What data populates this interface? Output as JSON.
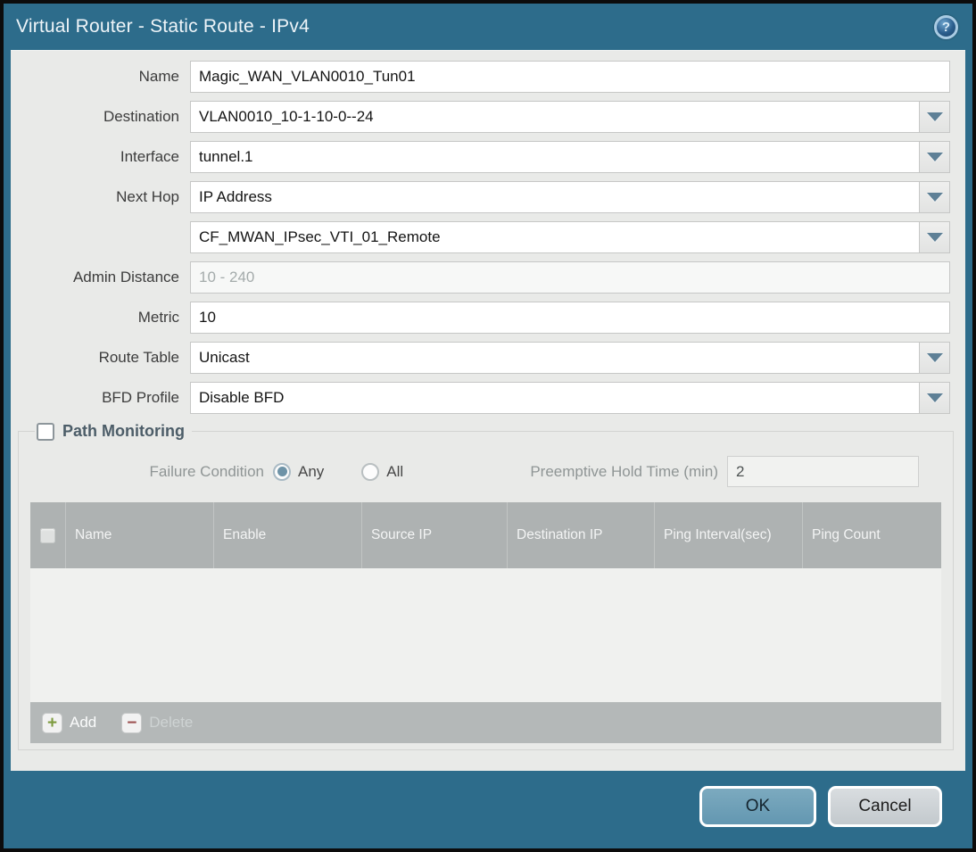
{
  "dialog": {
    "title": "Virtual Router - Static Route - IPv4",
    "help_icon_glyph": "?"
  },
  "form": {
    "fields": [
      {
        "label": "Name",
        "value": "Magic_WAN_VLAN0010_Tun01",
        "has_dropdown": false
      },
      {
        "label": "Destination",
        "value": "VLAN0010_10-1-10-0--24",
        "has_dropdown": true
      },
      {
        "label": "Interface",
        "value": "tunnel.1",
        "has_dropdown": true
      },
      {
        "label": "Next Hop",
        "value": "IP Address",
        "has_dropdown": true
      },
      {
        "label": "",
        "value": "CF_MWAN_IPsec_VTI_01_Remote",
        "has_dropdown": true
      },
      {
        "label": "Admin Distance",
        "value": "",
        "placeholder": "10 - 240",
        "has_dropdown": false
      },
      {
        "label": "Metric",
        "value": "10",
        "has_dropdown": false
      },
      {
        "label": "Route Table",
        "value": "Unicast",
        "has_dropdown": true
      },
      {
        "label": "BFD Profile",
        "value": "Disable BFD",
        "has_dropdown": true
      }
    ]
  },
  "path_monitoring": {
    "legend": "Path Monitoring",
    "enabled": false,
    "failure_condition_label": "Failure Condition",
    "failure_options": [
      {
        "label": "Any",
        "selected": true
      },
      {
        "label": "All",
        "selected": false
      }
    ],
    "preemptive_hold_label": "Preemptive Hold Time (min)",
    "preemptive_hold_value": "2",
    "table": {
      "columns": [
        "Name",
        "Enable",
        "Source IP",
        "Destination IP",
        "Ping Interval(sec)",
        "Ping Count"
      ],
      "rows": [],
      "add_label": "Add",
      "delete_label": "Delete"
    }
  },
  "footer": {
    "ok_label": "OK",
    "cancel_label": "Cancel"
  },
  "colors": {
    "titlebar_teal": "#2d6c8b",
    "ok_button_blue": "#6a9cb5",
    "radio_selected": "#6e93a7",
    "add_icon_green": "#7d9b3f",
    "delete_icon_red": "#9c5252",
    "table_header_gray": "#aeb2b2"
  }
}
